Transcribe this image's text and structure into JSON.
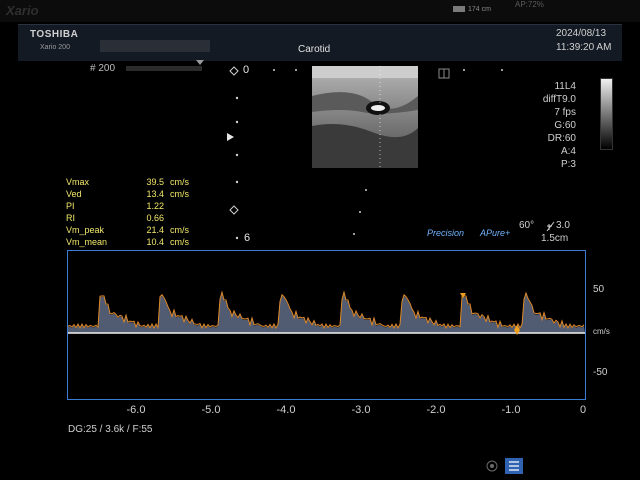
{
  "top_bar": {
    "brand": "Xario",
    "probe_line1": "174 cm",
    "ap": "AP:72%"
  },
  "header": {
    "manufacturer": "TOSHIBA",
    "model": "Xario 200",
    "exam": "Carotid",
    "date": "2024/08/13",
    "time": "11:39:20 AM"
  },
  "image": {
    "frame": "# 200",
    "depth_top": "0",
    "depth_bottom": "6"
  },
  "params": [
    "11L4",
    "diffT9.0",
    "7 fps",
    "",
    "G:60",
    "DR:60",
    "A:4",
    "P:3"
  ],
  "measurements": [
    {
      "label": "Vmax",
      "value": "39.5",
      "unit": "cm/s"
    },
    {
      "label": "Ved",
      "value": "13.4",
      "unit": "cm/s"
    },
    {
      "label": "PI",
      "value": "1.22",
      "unit": ""
    },
    {
      "label": "RI",
      "value": "0.66",
      "unit": ""
    },
    {
      "label": "Vm_peak",
      "value": "21.4",
      "unit": "cm/s"
    },
    {
      "label": "Vm_mean",
      "value": "10.4",
      "unit": "cm/s"
    }
  ],
  "doppler_info": {
    "precision": "Precision",
    "apure": "APure+",
    "angle": "60°",
    "gate": "3.0",
    "gate_size": "1.5cm"
  },
  "velocity_scale": {
    "top": "50",
    "unit": "cm/s",
    "bottom": "-50"
  },
  "time_axis": [
    "-6.0",
    "-5.0",
    "-4.0",
    "-3.0",
    "-2.0",
    "-1.0",
    "0"
  ],
  "footer": {
    "dg_line": "DG:25  / 3.6k  / F:55"
  }
}
